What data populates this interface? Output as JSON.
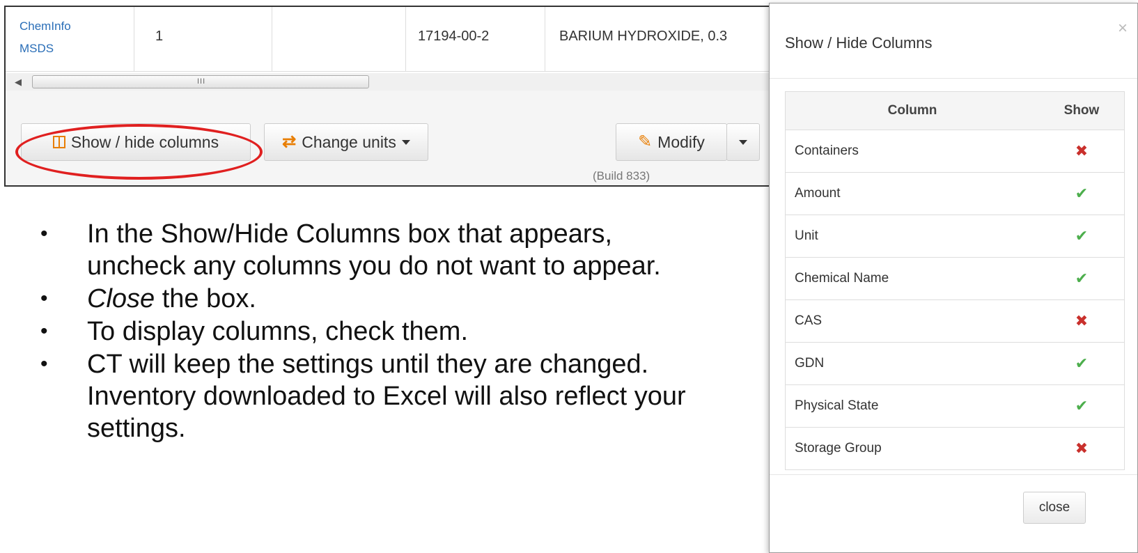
{
  "table": {
    "row": {
      "links": [
        "ChemInfo",
        "MSDS"
      ],
      "containers": "1",
      "amount": "",
      "cas": "17194-00-2",
      "chemical_name": "BARIUM HYDROXIDE, 0.3"
    },
    "scrollbar_grip": "III"
  },
  "toolbar": {
    "show_hide_label": "Show / hide columns",
    "change_units_label": "Change units",
    "modify_label": "Modify",
    "build": "(Build 833)"
  },
  "bullets": [
    "In the Show/Hide Columns box that appears, uncheck any columns you do not want to appear.",
    {
      "italic": "Close",
      "rest": " the box."
    },
    "To display columns, check them.",
    "CT will keep the settings until they are changed. Inventory downloaded to Excel will also reflect your settings."
  ],
  "modal": {
    "title": "Show / Hide Columns",
    "close_x": "×",
    "header_column": "Column",
    "header_show": "Show",
    "rows": [
      {
        "name": "Containers",
        "show": false
      },
      {
        "name": "Amount",
        "show": true
      },
      {
        "name": "Unit",
        "show": true
      },
      {
        "name": "Chemical Name",
        "show": true
      },
      {
        "name": "CAS",
        "show": false
      },
      {
        "name": "GDN",
        "show": true
      },
      {
        "name": "Physical State",
        "show": true
      },
      {
        "name": "Storage Group",
        "show": false
      }
    ],
    "close_button": "close"
  },
  "colors": {
    "accent_orange": "#e87e04",
    "link_blue": "#2a6eb7",
    "check_green": "#4cae4c",
    "cross_red": "#c9302c",
    "highlight_ellipse": "#e02020"
  }
}
